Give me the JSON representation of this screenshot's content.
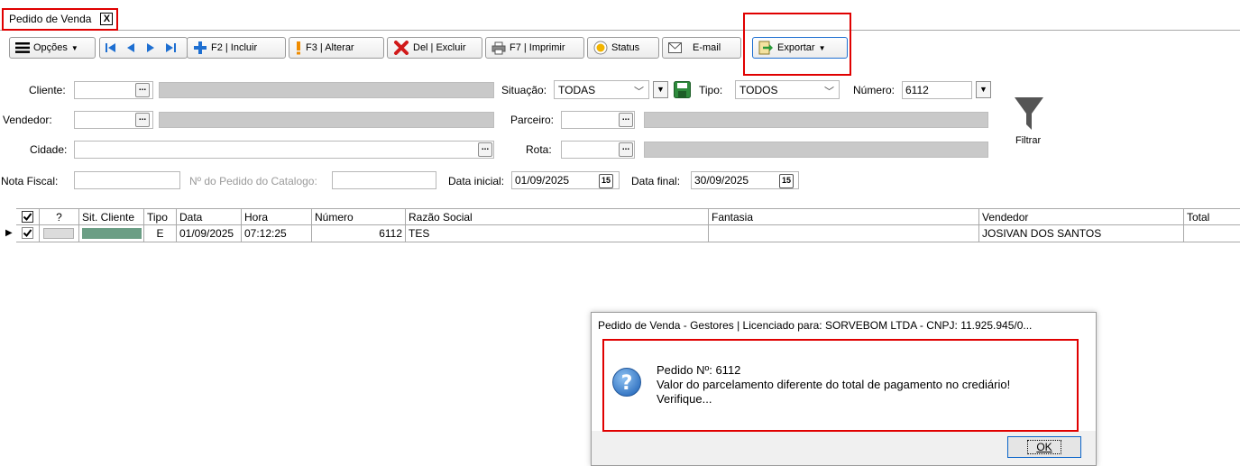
{
  "tab": {
    "label": "Pedido de Venda",
    "close": "X"
  },
  "toolbar": {
    "opcoes": "Opções",
    "incluir": "F2 | Incluir",
    "alterar": "F3 | Alterar",
    "excluir": "Del | Excluir",
    "imprimir": "F7 | Imprimir",
    "status": "Status",
    "email": "E-mail",
    "exportar": "Exportar"
  },
  "filters": {
    "cliente_label": "Cliente:",
    "vendedor_label": "Vendedor:",
    "cidade_label": "Cidade:",
    "nota_label": "Nota Fiscal:",
    "pedido_catalogo_label": "Nº do Pedido do Catalogo:",
    "situacao_label": "Situação:",
    "situacao_value": "TODAS",
    "tipo_label": "Tipo:",
    "tipo_value": "TODOS",
    "numero_label": "Número:",
    "numero_value": "6112",
    "parceiro_label": "Parceiro:",
    "rota_label": "Rota:",
    "data_inicial_label": "Data inicial:",
    "data_inicial_value": "01/09/2025",
    "data_final_label": "Data final:",
    "data_final_value": "30/09/2025",
    "filtrar": "Filtrar",
    "ellipsis": "...",
    "cal_label": "15"
  },
  "grid": {
    "columns": [
      "?",
      "Sit. Cliente",
      "Tipo",
      "Data",
      "Hora",
      "Número",
      "Razão Social",
      "Fantasia",
      "Vendedor",
      "Total"
    ],
    "rows": [
      {
        "tipo": "E",
        "data": "01/09/2025",
        "hora": "07:12:25",
        "numero": "6112",
        "razao": "TES",
        "fantasia": "",
        "vendedor": "JOSIVAN DOS SANTOS",
        "total": ""
      }
    ]
  },
  "dialog": {
    "title": "Pedido de Venda - Gestores | Licenciado para: SORVEBOM LTDA - CNPJ: 11.925.945/0...",
    "line1": "Pedido Nº: 6112",
    "line2": "Valor do parcelamento diferente do total de pagamento no crediário!",
    "line3": "Verifique...",
    "ok": "OK"
  },
  "colors": {
    "highlight": "#e00000",
    "status_bar": "#6b9e85",
    "accent_blue": "#1e6fd1"
  }
}
